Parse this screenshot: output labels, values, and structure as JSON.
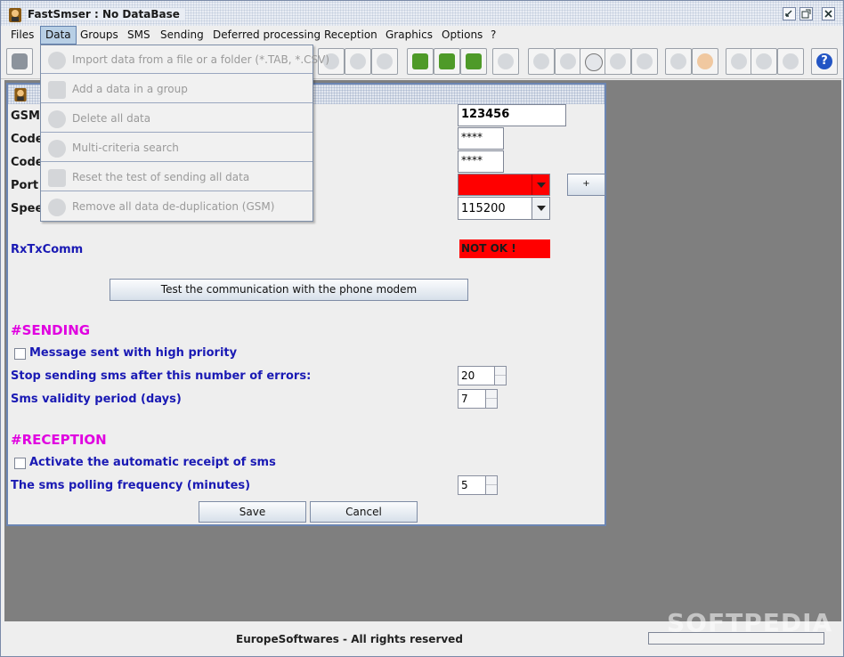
{
  "window": {
    "title": "FastSmser : No DataBase"
  },
  "menu": {
    "items": [
      "Files",
      "Data",
      "Groups",
      "SMS",
      "Sending",
      "Deferred processing",
      "Reception",
      "Graphics",
      "Options",
      "?"
    ],
    "active": "Data"
  },
  "data_menu": {
    "items": [
      "Import data from a file or a folder (*.TAB, *.CSV)",
      "Add a data in a group",
      "Delete all data",
      "Multi-criteria search",
      "Reset the test of sending all data",
      "Remove all data de-duplication (GSM)"
    ],
    "icons": [
      "import-icon",
      "group-add-icon",
      "delete-icon",
      "search-icon",
      "reset-icon",
      "dedup-icon"
    ]
  },
  "form": {
    "labels": {
      "gsm": "GSM",
      "code1": "Code",
      "code2": "Code",
      "port": "Port",
      "speed": "Spee",
      "rxtx": "RxTxComm"
    },
    "gsm_value": "123456",
    "code1_value": "****",
    "code2_value": "****",
    "port_value": "",
    "speed_value": "115200",
    "port_plus": "+",
    "rxtx_status": "NOT OK !",
    "test_button": "Test the communication with the phone modem",
    "sending_heading": "#SENDING",
    "high_priority_label": "Message sent with high priority",
    "stop_errors_label": "Stop sending sms after this number of errors:",
    "stop_errors_value": "20",
    "validity_label": "Sms validity period (days)",
    "validity_value": "7",
    "reception_heading": "#RECEPTION",
    "auto_receipt_label": "Activate the automatic receipt of sms",
    "polling_label": "The sms polling frequency (minutes)",
    "polling_value": "5",
    "save_button": "Save",
    "cancel_button": "Cancel"
  },
  "colors": {
    "error_red": "#ff0000",
    "heading_magenta": "#e000e0",
    "label_blue": "#1a1ab4"
  },
  "status": {
    "copyright": "EuropeSoftwares - All rights reserved",
    "progress": 0
  },
  "watermark": "SOFTPEDIA"
}
